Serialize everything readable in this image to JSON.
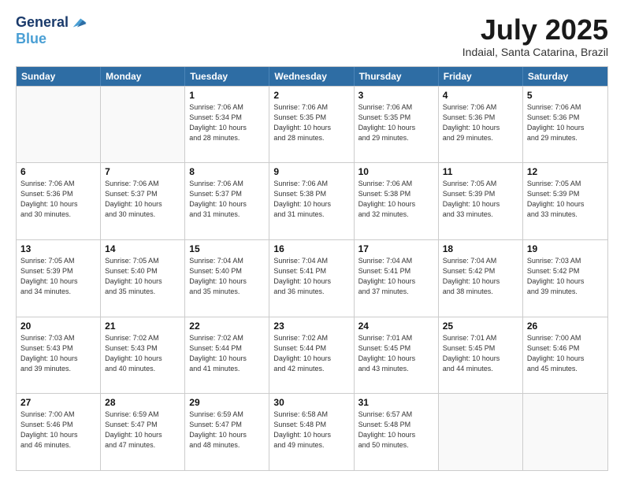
{
  "header": {
    "logo_line1": "General",
    "logo_line2": "Blue",
    "month": "July 2025",
    "location": "Indaial, Santa Catarina, Brazil"
  },
  "weekdays": [
    "Sunday",
    "Monday",
    "Tuesday",
    "Wednesday",
    "Thursday",
    "Friday",
    "Saturday"
  ],
  "weeks": [
    [
      {
        "day": "",
        "info": ""
      },
      {
        "day": "",
        "info": ""
      },
      {
        "day": "1",
        "info": "Sunrise: 7:06 AM\nSunset: 5:34 PM\nDaylight: 10 hours\nand 28 minutes."
      },
      {
        "day": "2",
        "info": "Sunrise: 7:06 AM\nSunset: 5:35 PM\nDaylight: 10 hours\nand 28 minutes."
      },
      {
        "day": "3",
        "info": "Sunrise: 7:06 AM\nSunset: 5:35 PM\nDaylight: 10 hours\nand 29 minutes."
      },
      {
        "day": "4",
        "info": "Sunrise: 7:06 AM\nSunset: 5:36 PM\nDaylight: 10 hours\nand 29 minutes."
      },
      {
        "day": "5",
        "info": "Sunrise: 7:06 AM\nSunset: 5:36 PM\nDaylight: 10 hours\nand 29 minutes."
      }
    ],
    [
      {
        "day": "6",
        "info": "Sunrise: 7:06 AM\nSunset: 5:36 PM\nDaylight: 10 hours\nand 30 minutes."
      },
      {
        "day": "7",
        "info": "Sunrise: 7:06 AM\nSunset: 5:37 PM\nDaylight: 10 hours\nand 30 minutes."
      },
      {
        "day": "8",
        "info": "Sunrise: 7:06 AM\nSunset: 5:37 PM\nDaylight: 10 hours\nand 31 minutes."
      },
      {
        "day": "9",
        "info": "Sunrise: 7:06 AM\nSunset: 5:38 PM\nDaylight: 10 hours\nand 31 minutes."
      },
      {
        "day": "10",
        "info": "Sunrise: 7:06 AM\nSunset: 5:38 PM\nDaylight: 10 hours\nand 32 minutes."
      },
      {
        "day": "11",
        "info": "Sunrise: 7:05 AM\nSunset: 5:39 PM\nDaylight: 10 hours\nand 33 minutes."
      },
      {
        "day": "12",
        "info": "Sunrise: 7:05 AM\nSunset: 5:39 PM\nDaylight: 10 hours\nand 33 minutes."
      }
    ],
    [
      {
        "day": "13",
        "info": "Sunrise: 7:05 AM\nSunset: 5:39 PM\nDaylight: 10 hours\nand 34 minutes."
      },
      {
        "day": "14",
        "info": "Sunrise: 7:05 AM\nSunset: 5:40 PM\nDaylight: 10 hours\nand 35 minutes."
      },
      {
        "day": "15",
        "info": "Sunrise: 7:04 AM\nSunset: 5:40 PM\nDaylight: 10 hours\nand 35 minutes."
      },
      {
        "day": "16",
        "info": "Sunrise: 7:04 AM\nSunset: 5:41 PM\nDaylight: 10 hours\nand 36 minutes."
      },
      {
        "day": "17",
        "info": "Sunrise: 7:04 AM\nSunset: 5:41 PM\nDaylight: 10 hours\nand 37 minutes."
      },
      {
        "day": "18",
        "info": "Sunrise: 7:04 AM\nSunset: 5:42 PM\nDaylight: 10 hours\nand 38 minutes."
      },
      {
        "day": "19",
        "info": "Sunrise: 7:03 AM\nSunset: 5:42 PM\nDaylight: 10 hours\nand 39 minutes."
      }
    ],
    [
      {
        "day": "20",
        "info": "Sunrise: 7:03 AM\nSunset: 5:43 PM\nDaylight: 10 hours\nand 39 minutes."
      },
      {
        "day": "21",
        "info": "Sunrise: 7:02 AM\nSunset: 5:43 PM\nDaylight: 10 hours\nand 40 minutes."
      },
      {
        "day": "22",
        "info": "Sunrise: 7:02 AM\nSunset: 5:44 PM\nDaylight: 10 hours\nand 41 minutes."
      },
      {
        "day": "23",
        "info": "Sunrise: 7:02 AM\nSunset: 5:44 PM\nDaylight: 10 hours\nand 42 minutes."
      },
      {
        "day": "24",
        "info": "Sunrise: 7:01 AM\nSunset: 5:45 PM\nDaylight: 10 hours\nand 43 minutes."
      },
      {
        "day": "25",
        "info": "Sunrise: 7:01 AM\nSunset: 5:45 PM\nDaylight: 10 hours\nand 44 minutes."
      },
      {
        "day": "26",
        "info": "Sunrise: 7:00 AM\nSunset: 5:46 PM\nDaylight: 10 hours\nand 45 minutes."
      }
    ],
    [
      {
        "day": "27",
        "info": "Sunrise: 7:00 AM\nSunset: 5:46 PM\nDaylight: 10 hours\nand 46 minutes."
      },
      {
        "day": "28",
        "info": "Sunrise: 6:59 AM\nSunset: 5:47 PM\nDaylight: 10 hours\nand 47 minutes."
      },
      {
        "day": "29",
        "info": "Sunrise: 6:59 AM\nSunset: 5:47 PM\nDaylight: 10 hours\nand 48 minutes."
      },
      {
        "day": "30",
        "info": "Sunrise: 6:58 AM\nSunset: 5:48 PM\nDaylight: 10 hours\nand 49 minutes."
      },
      {
        "day": "31",
        "info": "Sunrise: 6:57 AM\nSunset: 5:48 PM\nDaylight: 10 hours\nand 50 minutes."
      },
      {
        "day": "",
        "info": ""
      },
      {
        "day": "",
        "info": ""
      }
    ]
  ]
}
